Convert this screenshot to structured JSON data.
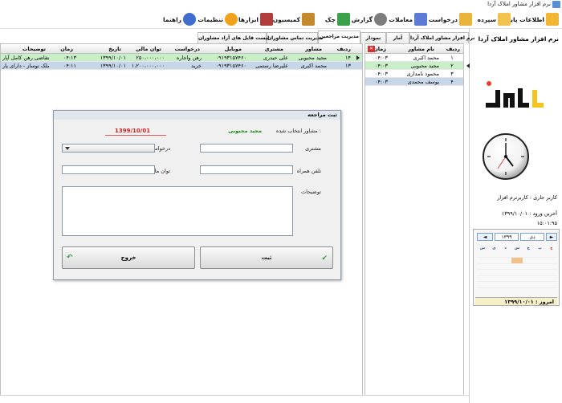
{
  "window": {
    "title": "نرم افزار مشاور املاک آردا"
  },
  "toolbar": {
    "items": [
      {
        "label": "اطلاعات پایه",
        "icon": "folder-add-icon",
        "color": "#f3b335"
      },
      {
        "label": "سپرده",
        "icon": "folder-plus-icon",
        "color": "#f2c24e"
      },
      {
        "label": "درخواست",
        "icon": "request-folder-icon",
        "color": "#e8b43a"
      },
      {
        "label": "معاملات",
        "icon": "pen-paper-icon",
        "color": "#5b7bd5"
      },
      {
        "label": "گزارش",
        "icon": "magnifier-icon",
        "color": "#7d7d7d"
      },
      {
        "label": "چک",
        "icon": "check-card-icon",
        "color": "#3aa14a"
      },
      {
        "label": "کمیسیون",
        "icon": "coins-icon",
        "color": "#c28a2d"
      },
      {
        "label": "ابزارها",
        "icon": "tools-icon",
        "color": "#b13c3c"
      },
      {
        "label": "تنظیمات",
        "icon": "gear-icon",
        "color": "#f1a21c"
      },
      {
        "label": "راهنما",
        "icon": "help-icon",
        "color": "#3f6ecf"
      }
    ]
  },
  "right_panel": {
    "title": "نرم افزار مشاور املاک آردا",
    "logo_text": "آردا",
    "current_user": "کاربر جاری : کاربرنرم افزار",
    "last_login_label": "آخرین ورود : ۱۳۹۹/۱۰/۰۱",
    "last_login_time": "۱۵:۰۱:۹۵",
    "calendar": {
      "month": "دی",
      "year": "۱۳۹۹",
      "weekdays": [
        "ش",
        "ی",
        "د",
        "س",
        "چ",
        "پ",
        "ج"
      ],
      "today_label": "امروز : ۱۳۹۹/۱۰/۰۱"
    }
  },
  "consultants": {
    "columns": [
      "ردیف",
      "نام مشاور",
      "زمان"
    ],
    "rows": [
      {
        "index": "۱",
        "name": "محمد اکبری",
        "time": "۰۴:۰۳"
      },
      {
        "index": "۲",
        "name": "مجید محبوبی",
        "time": "۰۴:۰۳"
      },
      {
        "index": "۳",
        "name": "محمود نامداری",
        "time": "۰۴:۰۳"
      },
      {
        "index": "۴",
        "name": "یوسف محمدی",
        "time": "۰۴:۰۳"
      }
    ]
  },
  "tabs": [
    {
      "label": "نرم افزار مشاور املاک آردا"
    },
    {
      "label": "آمار"
    },
    {
      "label": "نمودار"
    },
    {
      "label": "مدیریت مراجعین"
    },
    {
      "label": "مدیریت تماس مشاوران"
    },
    {
      "label": "لیست فایل های آزاد مشاوران"
    }
  ],
  "referrals": {
    "columns": [
      "ردیف",
      "مشاور",
      "مشتری",
      "موبایل",
      "درخواست",
      "توان مالی",
      "تاریخ",
      "زمان",
      "توضیحات"
    ],
    "rows": [
      {
        "index": "۱۴",
        "consultant": "مجید محبوبی",
        "customer": "علی حیدری",
        "mobile": "۰۹۱۹۳۱۵۷۴۶۰",
        "request": "رهن واجاره",
        "finance": "۲۵۰،۰۰۰،۰۰۰",
        "date": "۱۳۹۹/۱۰/۰۱",
        "time": "۰۴:۱۳",
        "notes": "متقاضی رهن کامل آپار"
      },
      {
        "index": "۱۳",
        "consultant": "محمد اکبری",
        "customer": "علیرضا رستمی",
        "mobile": "۰۹۱۹۳۱۵۷۴۶۰",
        "request": "خرید",
        "finance": "۱،۲۰۰،۰۰۰،۰۰۰",
        "date": "۱۳۹۹/۱۰/۰۱",
        "time": "۰۴:۱۱",
        "notes": "ملک نوساز - دارای پار"
      }
    ]
  },
  "dialog": {
    "title": "ثبت مراجعه",
    "date": "1399/10/01",
    "selected_consultant_label": "مشاور انتخاب شده :",
    "selected_consultant": "مجید محبوبی",
    "customer_label": "مشتری",
    "request_label": "درخواست",
    "mobile_label": "تلفن همراه",
    "finance_label": "توان مالی",
    "notes_label": "توضیحات",
    "submit_label": "ثبت",
    "exit_label": "خروج"
  }
}
